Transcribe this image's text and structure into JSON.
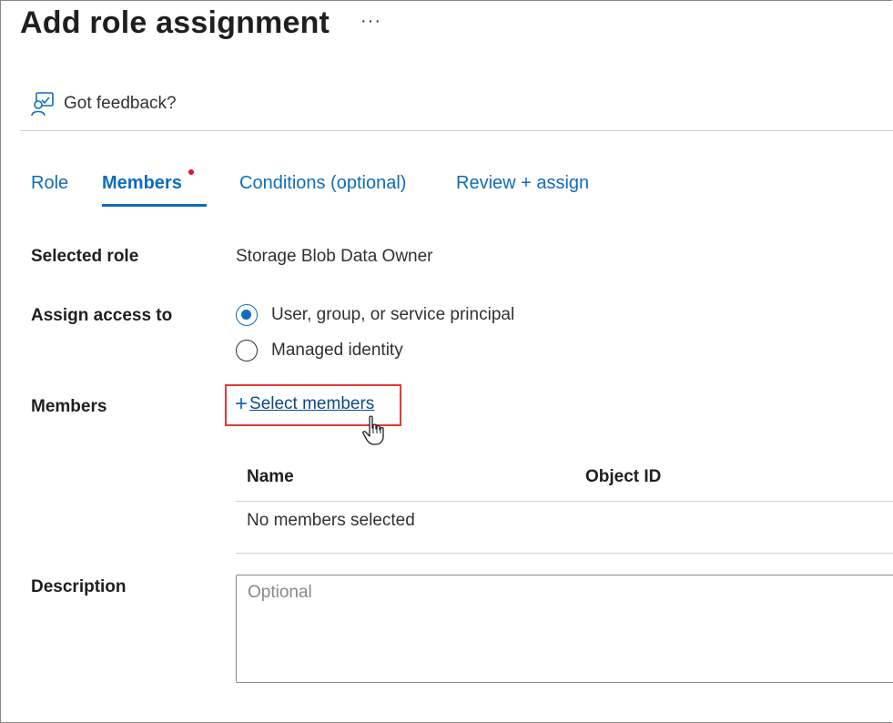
{
  "header": {
    "title": "Add role assignment",
    "more_label": "···"
  },
  "feedback": {
    "label": "Got feedback?",
    "icon": "feedback-person-icon"
  },
  "tabs": [
    {
      "label": "Role",
      "active": false
    },
    {
      "label": "Members",
      "active": true,
      "has_indicator": true
    },
    {
      "label": "Conditions (optional)",
      "active": false
    },
    {
      "label": "Review + assign",
      "active": false
    }
  ],
  "form": {
    "selected_role": {
      "label": "Selected role",
      "value": "Storage Blob Data Owner"
    },
    "assign_access": {
      "label": "Assign access to",
      "options": [
        {
          "label": "User, group, or service principal",
          "checked": true
        },
        {
          "label": "Managed identity",
          "checked": false
        }
      ]
    },
    "members": {
      "label": "Members",
      "select_label": "Select members",
      "columns": [
        "Name",
        "Object ID"
      ],
      "empty_text": "No members selected"
    },
    "description": {
      "label": "Description",
      "placeholder": "Optional",
      "value": ""
    }
  },
  "colors": {
    "accent": "#0f6cbd",
    "highlight_box": "#e53935",
    "indicator": "#e81123"
  }
}
